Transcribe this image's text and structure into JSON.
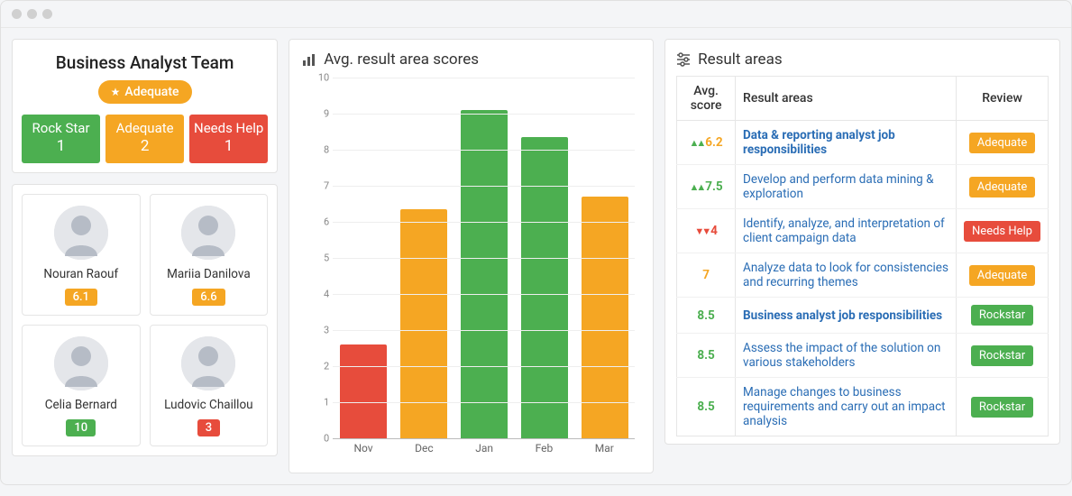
{
  "colors": {
    "green": "#4caf50",
    "orange": "#f5a623",
    "red": "#e74c3c"
  },
  "team": {
    "title": "Business Analyst Team",
    "overall_label": "Adequate",
    "overall_color": "#f5a623",
    "counts": [
      {
        "label": "Rock Star",
        "value": "1",
        "color": "#4caf50"
      },
      {
        "label": "Adequate",
        "value": "2",
        "color": "#f5a623"
      },
      {
        "label": "Needs Help",
        "value": "1",
        "color": "#e74c3c"
      }
    ]
  },
  "members": [
    {
      "name": "Nouran Raouf",
      "score": "6.1",
      "color": "#f5a623"
    },
    {
      "name": "Mariia Danilova",
      "score": "6.6",
      "color": "#f5a623"
    },
    {
      "name": "Celia Bernard",
      "score": "10",
      "color": "#4caf50"
    },
    {
      "name": "Ludovic Chaillou",
      "score": "3",
      "color": "#e74c3c"
    }
  ],
  "chart_panel_title": "Avg. result area scores",
  "chart_data": {
    "type": "bar",
    "title": "Avg. result area scores",
    "xlabel": "",
    "ylabel": "",
    "ylim": [
      0,
      10
    ],
    "yticks": [
      0,
      1,
      2,
      3,
      4,
      5,
      6,
      7,
      8,
      9,
      10
    ],
    "categories": [
      "Nov",
      "Dec",
      "Jan",
      "Feb",
      "Mar"
    ],
    "values": [
      2.6,
      6.35,
      9.1,
      8.35,
      6.7
    ],
    "bar_colors": [
      "#e74c3c",
      "#f5a623",
      "#4caf50",
      "#4caf50",
      "#f5a623"
    ]
  },
  "result_panel_title": "Result areas",
  "result_table": {
    "headers": {
      "score": "Avg. score",
      "area": "Result areas",
      "review": "Review"
    },
    "rows": [
      {
        "score": "6.2",
        "trend": "up",
        "score_color": "#f5a623",
        "area": "Data & reporting analyst job responsibilities",
        "bold": true,
        "review": "Adequate",
        "review_color": "#f5a623"
      },
      {
        "score": "7.5",
        "trend": "up",
        "score_color": "#4caf50",
        "area": "Develop and perform data mining & exploration",
        "bold": false,
        "review": "Adequate",
        "review_color": "#f5a623"
      },
      {
        "score": "4",
        "trend": "down",
        "score_color": "#e74c3c",
        "area": "Identify, analyze, and interpretation of client campaign data",
        "bold": false,
        "review": "Needs Help",
        "review_color": "#e74c3c"
      },
      {
        "score": "7",
        "trend": "none",
        "score_color": "#f5a623",
        "area": "Analyze data to look for consistencies and recurring themes",
        "bold": false,
        "review": "Adequate",
        "review_color": "#f5a623"
      },
      {
        "score": "8.5",
        "trend": "none",
        "score_color": "#4caf50",
        "area": "Business analyst job responsibilities",
        "bold": true,
        "review": "Rockstar",
        "review_color": "#4caf50"
      },
      {
        "score": "8.5",
        "trend": "none",
        "score_color": "#4caf50",
        "area": "Assess the impact of the solution on various stakeholders",
        "bold": false,
        "review": "Rockstar",
        "review_color": "#4caf50"
      },
      {
        "score": "8.5",
        "trend": "none",
        "score_color": "#4caf50",
        "area": "Manage changes to business requirements and carry out an impact analysis",
        "bold": false,
        "review": "Rockstar",
        "review_color": "#4caf50"
      }
    ]
  }
}
